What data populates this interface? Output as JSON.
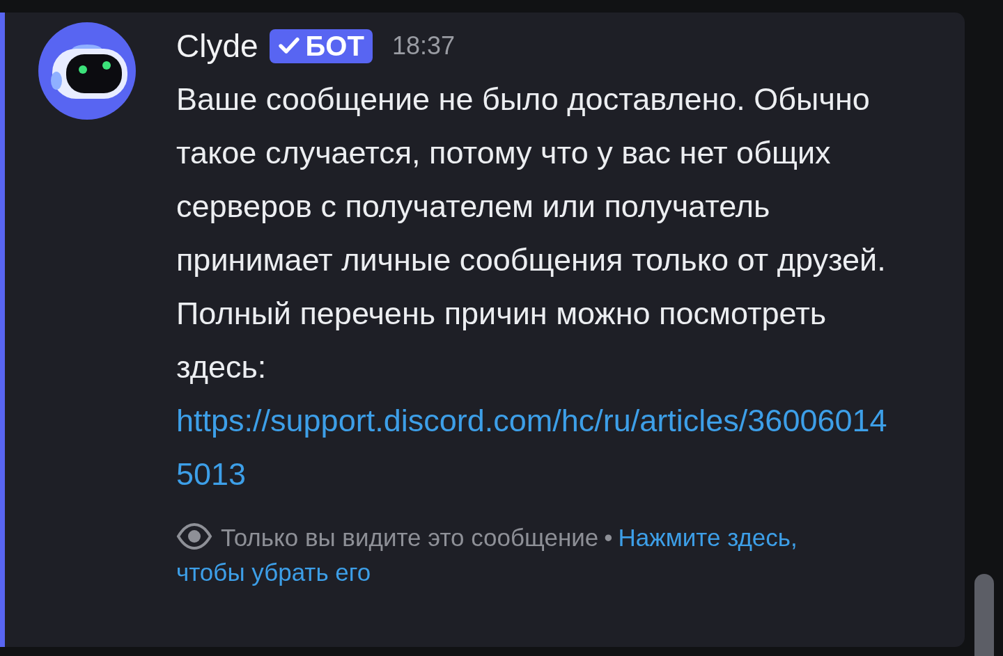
{
  "message": {
    "author": "Clyde",
    "badge": {
      "label": "БОТ",
      "verified": true
    },
    "time": "18:37",
    "text": "Ваше сообщение не было доставлено. Обычно такое случается, потому что у вас нет общих серверов с получателем или получатель принимает личные сообщения только от друзей. Полный перечень причин можно посмотреть здесь:",
    "link": "https://support.discord.com/hc/ru/articles/360060145013",
    "footer": {
      "note": "Только вы видите это сообщение",
      "separator": "•",
      "dismiss": [
        "Нажмите здесь,",
        "чтобы убрать его"
      ]
    }
  }
}
